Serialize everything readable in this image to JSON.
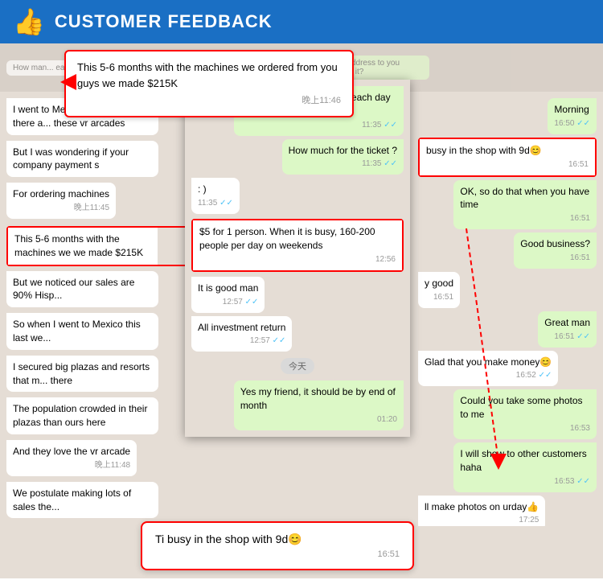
{
  "header": {
    "icon": "👍",
    "title": "CUSTOMER FEEDBACK"
  },
  "top_highlight": {
    "text": "This 5-6 months with the machines we ordered from you guys we made $215K",
    "time": "晚上11:46"
  },
  "bottom_highlight": {
    "text": "Ti busy in the shop with 9d😊",
    "time": "16:51"
  },
  "left_panel": {
    "messages": [
      {
        "type": "received",
        "text": "I went to Mexico and oh mine there are these vr arcades",
        "time": ""
      },
      {
        "type": "received",
        "text": "But I was wondering if your company payment s",
        "time": ""
      },
      {
        "type": "received",
        "text": "For ordering machines",
        "time": "晚上11:45"
      },
      {
        "type": "received",
        "text": "This 5-6 months with the machines we we made $215K",
        "time": "",
        "highlight": true
      },
      {
        "type": "received",
        "text": "But we noticed our sales are 90% Hisp...",
        "time": ""
      },
      {
        "type": "received",
        "text": "So when I went to Mexico this last we...",
        "time": ""
      },
      {
        "type": "received",
        "text": "I secured big plazas and resorts that m... there",
        "time": ""
      },
      {
        "type": "received",
        "text": "The population crowded in their plazas than ours here",
        "time": ""
      },
      {
        "type": "received",
        "text": "And they love the vr arcade",
        "time": "晚上11:48"
      },
      {
        "type": "received",
        "text": "We postulate making lots of sales the...",
        "time": ""
      }
    ]
  },
  "center_panel": {
    "messages": [
      {
        "type": "sent",
        "text": "How many people played each day ?",
        "time": "11:35",
        "checks": "✓✓"
      },
      {
        "type": "sent",
        "text": "How much for the ticket ?",
        "time": "11:35",
        "checks": "✓✓"
      },
      {
        "type": "received",
        "text": ": )",
        "time": "11:35",
        "checks": "✓✓"
      },
      {
        "type": "received",
        "text": "$5 for 1 person. When it is busy, 160-200 people per day on weekends",
        "time": "12:56",
        "highlight": true
      },
      {
        "type": "received",
        "text": "It is good man",
        "time": "12:57",
        "checks": "✓✓"
      },
      {
        "type": "received",
        "text": "All investment return",
        "time": "12:57",
        "checks": "✓✓"
      },
      {
        "type": "date",
        "text": "今天"
      },
      {
        "type": "sent",
        "text": "Yes my friend, it should be by end of month",
        "time": "01:20"
      }
    ]
  },
  "right_panel": {
    "messages": [
      {
        "type": "sent",
        "text": "Morning",
        "time": "16:50",
        "checks": "✓✓"
      },
      {
        "type": "received",
        "text": "busy in the shop with 9d😊",
        "time": "16:51",
        "highlight": true
      },
      {
        "type": "sent",
        "text": "OK, so do that when you have time",
        "time": "16:51"
      },
      {
        "type": "sent",
        "text": "Good business?",
        "time": "16:51"
      },
      {
        "type": "received",
        "text": "y good",
        "time": "16:51"
      },
      {
        "type": "sent",
        "text": "Great man",
        "time": "16:51",
        "checks": "✓✓"
      },
      {
        "type": "received",
        "text": "Glad that you make money😊",
        "time": "16:52",
        "checks": "✓✓"
      },
      {
        "type": "sent",
        "text": "Could you take some photos to me",
        "time": "16:53"
      },
      {
        "type": "sent",
        "text": "I will show to other customers haha",
        "time": "16:53",
        "checks": "✓✓"
      },
      {
        "type": "received",
        "text": "ll make photos on urday👍",
        "time": "17:25"
      }
    ]
  }
}
